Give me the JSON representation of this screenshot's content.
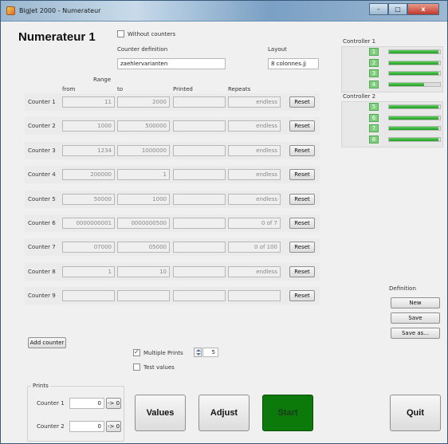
{
  "window": {
    "title": "BigJet 2000  -  Numerateur",
    "buttons": [
      "–",
      "□",
      "x"
    ]
  },
  "header": {
    "title": "Numerateur 1",
    "without_counters_label": "Without counters",
    "without_counters_checked": false,
    "counter_definition_label": "Counter definition",
    "counter_definition_value": "zaehlervarianten",
    "layout_label": "Layout",
    "layout_value": "8 colonnes.jj"
  },
  "table": {
    "range_label": "Range",
    "headers": {
      "from": "from",
      "to": "to",
      "printed": "Printed",
      "repeats": "Repeats"
    },
    "reset_label": "Reset",
    "rows": [
      {
        "label": "Counter  1",
        "from": "11",
        "to": "2000",
        "printed": "",
        "repeats": "endless"
      },
      {
        "label": "Counter  2",
        "from": "1000",
        "to": "500000",
        "printed": "",
        "repeats": "endless"
      },
      {
        "label": "Counter  3",
        "from": "1234",
        "to": "1000000",
        "printed": "",
        "repeats": "endless"
      },
      {
        "label": "Counter  4",
        "from": "200000",
        "to": "1",
        "printed": "",
        "repeats": "endless"
      },
      {
        "label": "Counter  5",
        "from": "50000",
        "to": "1000",
        "printed": "",
        "repeats": "endless"
      },
      {
        "label": "Counter  6",
        "from": "0000000001",
        "to": "0000000500",
        "printed": "",
        "repeats": "0 of 7"
      },
      {
        "label": "Counter  7",
        "from": "07000",
        "to": "05000",
        "printed": "",
        "repeats": "0 of 100"
      },
      {
        "label": "Counter  8",
        "from": "1",
        "to": "10",
        "printed": "",
        "repeats": "endless"
      },
      {
        "label": "Counter  9",
        "from": "",
        "to": "",
        "printed": "",
        "repeats": ""
      }
    ]
  },
  "controllers": [
    {
      "title": "Controller 1",
      "channels": [
        {
          "num": "1",
          "level": 0.97
        },
        {
          "num": "2",
          "level": 0.97
        },
        {
          "num": "3",
          "level": 0.97
        },
        {
          "num": "4",
          "level": 0.68
        }
      ]
    },
    {
      "title": "Controller 2",
      "channels": [
        {
          "num": "5",
          "level": 0.97
        },
        {
          "num": "6",
          "level": 0.97
        },
        {
          "num": "7",
          "level": 0.97
        },
        {
          "num": "8",
          "level": 0.97
        }
      ]
    }
  ],
  "definition": {
    "title": "Definition",
    "new_label": "New",
    "save_label": "Save",
    "save_as_label": "Save as..."
  },
  "controls": {
    "add_counter_label": "Add counter",
    "multiple_prints_label": "Multiple Prints",
    "multiple_prints_checked": true,
    "multiple_prints_value": "5",
    "test_values_label": "Test values",
    "test_values_checked": false
  },
  "prints": {
    "title": "Prints",
    "reset_label": "-> 0",
    "rows": [
      {
        "label": "Counter 1",
        "value": "0"
      },
      {
        "label": "Counter 2",
        "value": "0"
      }
    ]
  },
  "actions": {
    "values_label": "Values",
    "adjust_label": "Adjust",
    "start_label": "Start",
    "quit_label": "Quit"
  },
  "colors": {
    "start_green": "#0b7a0b",
    "channel_green": "#7fcf7f"
  }
}
